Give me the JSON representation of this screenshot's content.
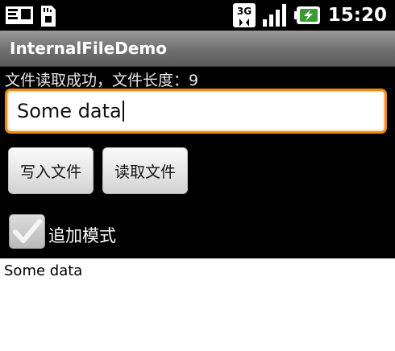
{
  "status_bar": {
    "time": "15:20",
    "network": "3G",
    "icons": [
      "notification-icon",
      "sdcard-icon",
      "network-3g-icon",
      "signal-icon",
      "battery-charging-icon"
    ]
  },
  "app": {
    "title": "InternalFileDemo"
  },
  "main": {
    "status_text": "文件读取成功，文件长度：9",
    "input_value": "Some data",
    "write_button": "写入文件",
    "read_button": "读取文件",
    "append_checkbox_label": "追加模式",
    "append_checked": true,
    "output_text": "Some data"
  },
  "colors": {
    "focus_border": "#f08a12",
    "background": "#000000"
  }
}
